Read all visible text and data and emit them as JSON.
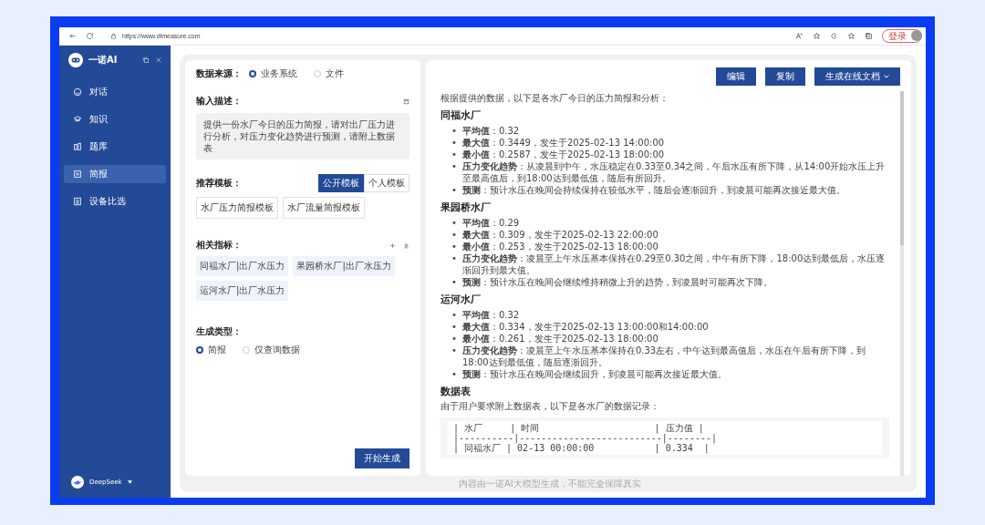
{
  "browser": {
    "url": "https://www.dlmeasure.com",
    "login_label": "登录"
  },
  "sidebar": {
    "app_name": "一诺AI",
    "items": [
      {
        "label": "对话",
        "selected": false
      },
      {
        "label": "知识",
        "selected": false
      },
      {
        "label": "题库",
        "selected": false
      },
      {
        "label": "简报",
        "selected": true
      },
      {
        "label": "设备比选",
        "selected": false
      }
    ],
    "model": "DeepSeek"
  },
  "form": {
    "source_label": "数据来源：",
    "sources": [
      {
        "label": "业务系统",
        "selected": true
      },
      {
        "label": "文件",
        "selected": false
      }
    ],
    "description_label": "输入描述：",
    "description": "提供一份水厂今日的压力简报，请对出厂压力进行分析，对压力变化趋势进行预测，请附上数据表",
    "template_label": "推荐模板：",
    "template_tabs": [
      {
        "label": "公开模板",
        "selected": true
      },
      {
        "label": "个人模板",
        "selected": false
      }
    ],
    "templates": [
      "水厂压力简报模板",
      "水厂流量简报模板"
    ],
    "indicators_label": "相关指标：",
    "indicators": [
      "同福水厂|出厂水压力",
      "果园桥水厂|出厂水压力",
      "运河水厂|出厂水压力"
    ],
    "type_label": "生成类型：",
    "types": [
      {
        "label": "简报",
        "selected": true
      },
      {
        "label": "仅查询数据",
        "selected": false
      }
    ],
    "submit": "开始生成"
  },
  "result": {
    "actions": [
      {
        "label": "编辑",
        "dropdown": false
      },
      {
        "label": "复制",
        "dropdown": false
      },
      {
        "label": "生成在线文档",
        "dropdown": true
      }
    ],
    "intro": "根据提供的数据，以下是各水厂今日的压力简报和分析：",
    "bullet_marker": "•",
    "sections": [
      {
        "title": "同福水厂",
        "items": [
          "**平均值**：0.32",
          "**最大值**：0.3449，发生于2025-02-13 14:00:00",
          "**最小值**：0.2587，发生于2025-02-13 18:00:00",
          "**压力变化趋势**：从凌晨到中午，水压稳定在0.33至0.34之间，午后水压有所下降，从14:00开始水压上升至最高值后，到18:00达到最低值，随后有所回升。",
          "**预测**：预计水压在晚间会持续保持在较低水平，随后会逐渐回升，到凌晨可能再次接近最大值。"
        ]
      },
      {
        "title": "果园桥水厂",
        "items": [
          "**平均值**：0.29",
          "**最大值**：0.309，发生于2025-02-13 22:00:00",
          "**最小值**：0.253，发生于2025-02-13 18:00:00",
          "**压力变化趋势**：凌晨至上午水压基本保持在0.29至0.30之间，中午有所下降，18:00达到最低后，水压逐渐回升到最大值。",
          "**预测**：预计水压在晚间会继续维持稍微上升的趋势，到凌晨时可能再次下降。"
        ]
      },
      {
        "title": "运河水厂",
        "items": [
          "**平均值**：0.32",
          "**最大值**：0.334，发生于2025-02-13 13:00:00和14:00:00",
          "**最小值**：0.261，发生于2025-02-13 18:00:00",
          "**压力变化趋势**：凌晨至上午水压基本保持在0.33左右，中午达到最高值后，水压在午后有所下降，到18:00达到最低值，随后逐渐回升。",
          "**预测**：预计水压在晚间会继续回升，到凌晨可能再次接近最大值。"
        ]
      }
    ],
    "table_title": "数据表",
    "table_intro": "由于用户要求附上数据表，以下是各水厂的数据记录：",
    "table_lines": [
      "| 水厂     | 时间                     | 压力值 |",
      "|----------|--------------------------|--------|",
      "| 同福水厂 | 02-13 00:00:00           | 0.334  |"
    ]
  },
  "footer_note": "内容由一诺AI大模型生成，不能完全保障真实"
}
